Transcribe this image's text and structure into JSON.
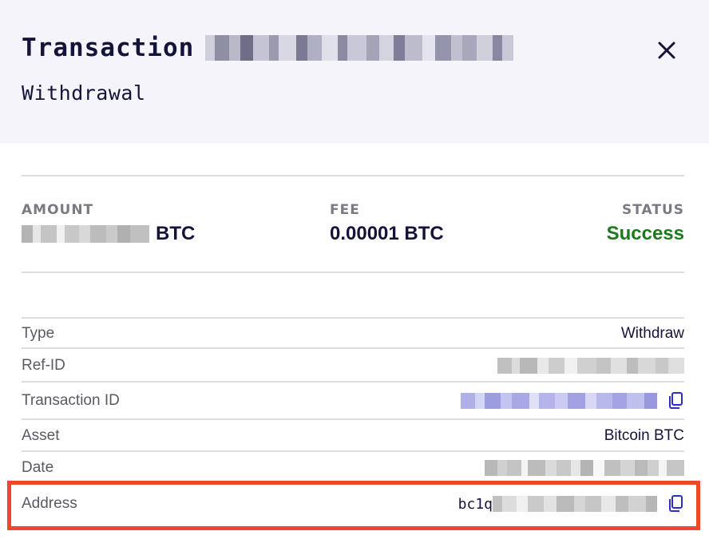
{
  "header": {
    "title": "Transaction",
    "subtitle": "Withdrawal",
    "close_symbol": "✕"
  },
  "summary": {
    "amount": {
      "label": "AMOUNT",
      "currency": "BTC"
    },
    "fee": {
      "label": "FEE",
      "value": "0.00001 BTC"
    },
    "status": {
      "label": "STATUS",
      "value": "Success",
      "color": "#1b7a1b"
    }
  },
  "details": {
    "type": {
      "label": "Type",
      "value": "Withdraw"
    },
    "ref_id": {
      "label": "Ref-ID"
    },
    "transaction_id": {
      "label": "Transaction ID"
    },
    "asset": {
      "label": "Asset",
      "value": "Bitcoin BTC"
    },
    "date": {
      "label": "Date"
    },
    "address": {
      "label": "Address",
      "prefix": "bc1q"
    }
  },
  "colors": {
    "header_bg": "#f4f4fa",
    "accent_link": "#2d2dc8",
    "highlight": "#f0462a"
  },
  "icons": [
    "close-icon",
    "copy-icon"
  ]
}
